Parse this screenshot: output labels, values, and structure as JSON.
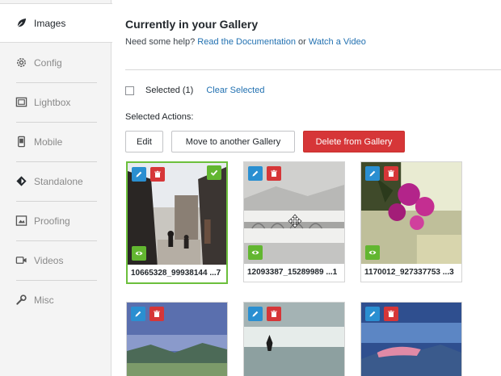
{
  "sidebar": {
    "tabs": [
      {
        "id": "images",
        "label": "Images",
        "icon": "leaf-icon",
        "active": true
      },
      {
        "id": "config",
        "label": "Config",
        "icon": "gear-icon",
        "active": false
      },
      {
        "id": "lightbox",
        "label": "Lightbox",
        "icon": "lightbox-icon",
        "active": false
      },
      {
        "id": "mobile",
        "label": "Mobile",
        "icon": "mobile-icon",
        "active": false
      },
      {
        "id": "standalone",
        "label": "Standalone",
        "icon": "diamond-icon",
        "active": false
      },
      {
        "id": "proofing",
        "label": "Proofing",
        "icon": "proofing-icon",
        "active": false
      },
      {
        "id": "videos",
        "label": "Videos",
        "icon": "video-icon",
        "active": false
      },
      {
        "id": "misc",
        "label": "Misc",
        "icon": "wrench-icon",
        "active": false
      }
    ]
  },
  "main": {
    "title": "Currently in your Gallery",
    "help_prefix": "Need some help?",
    "help_link_docs": "Read the Documentation",
    "help_or": "or",
    "help_link_video": "Watch a Video",
    "selected_label": "Selected",
    "selected_count": "(1)",
    "clear_selected": "Clear Selected",
    "actions_label": "Selected Actions:",
    "buttons": {
      "edit": "Edit",
      "move": "Move to another Gallery",
      "delete": "Delete from Gallery"
    }
  },
  "colors": {
    "accent_blue": "#2a8fd1",
    "delete_red": "#d63638",
    "selected_green": "#62b630",
    "link": "#2271b1"
  },
  "gallery": [
    {
      "name": "10665328_99938144 ...7",
      "selected": true
    },
    {
      "name": "12093387_15289989 ...1",
      "selected": false
    },
    {
      "name": "1170012_927337753 ...3",
      "selected": false
    },
    {
      "name": "",
      "selected": false
    },
    {
      "name": "",
      "selected": false
    },
    {
      "name": "",
      "selected": false
    }
  ]
}
